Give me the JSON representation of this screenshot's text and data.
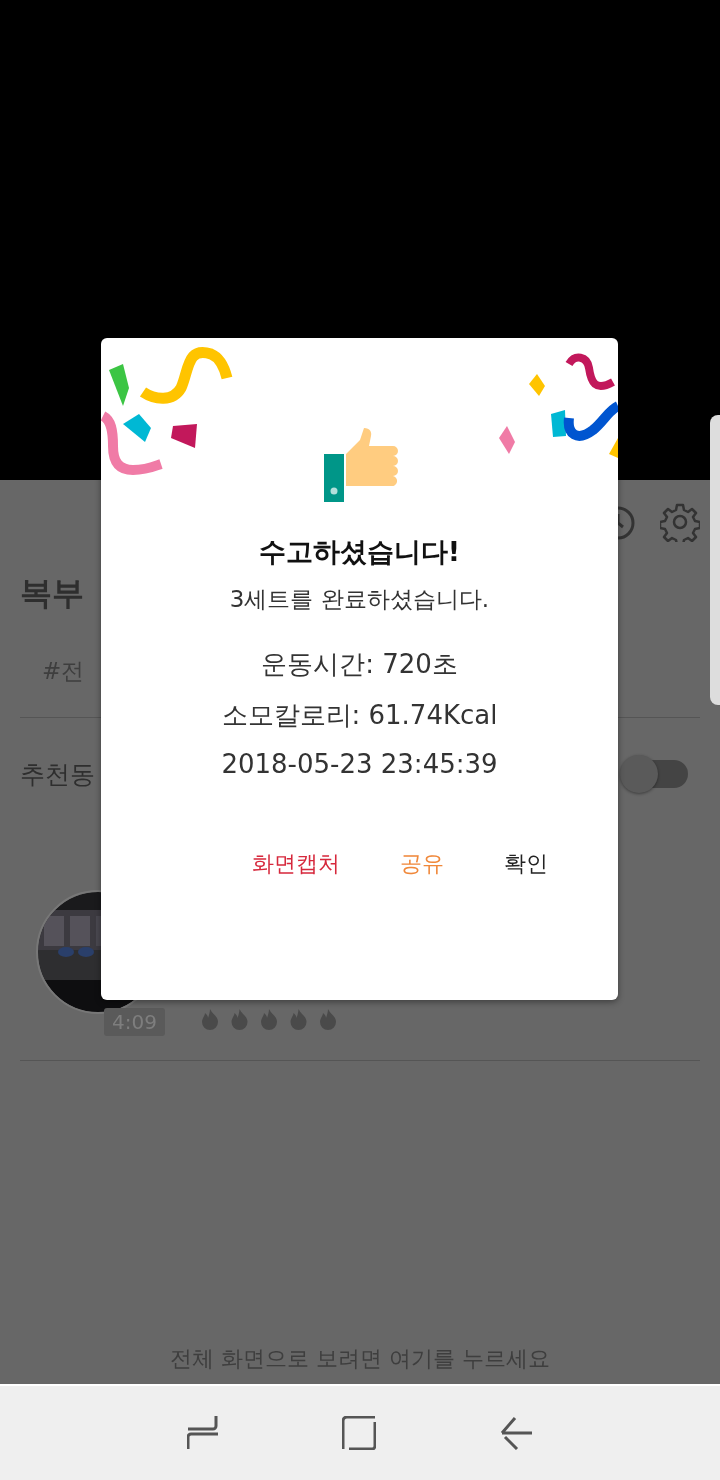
{
  "background": {
    "title": "복부",
    "tag": "#전",
    "section_label": "추천동",
    "autoplay_toggle": {
      "on": false
    },
    "video": {
      "duration": "4:09"
    },
    "hint": "전체 화면으로 보려면 여기를 누르세요"
  },
  "dialog": {
    "title": "수고하셨습니다!",
    "message": "3세트를 완료하셨습니다.",
    "stats": [
      "운동시간: 720초",
      "소모칼로리: 61.74Kcal",
      "2018-05-23 23:45:39"
    ],
    "buttons": [
      {
        "label": "화면캡처",
        "color": "#d6283c"
      },
      {
        "label": "공유",
        "color": "#f0883a"
      },
      {
        "label": "확인",
        "color": "#222222"
      }
    ]
  }
}
